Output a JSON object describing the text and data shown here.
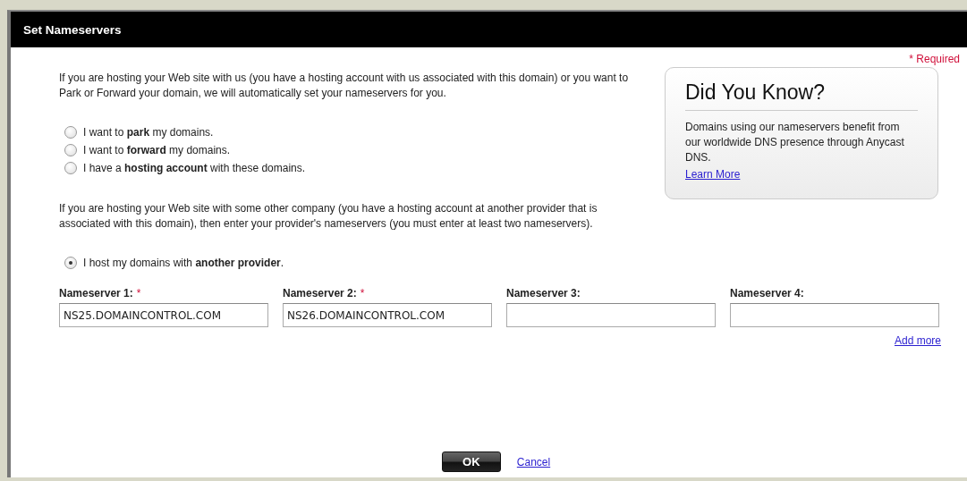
{
  "dialog": {
    "title": "Set Nameservers",
    "required_note": "* Required"
  },
  "intro": "If you are hosting your Web site with us (you have a hosting account with us associated with this domain) or you want to Park or Forward your domain, we will automatically set your nameservers for you.",
  "options": [
    {
      "label": "I want to **park** my domains.",
      "selected": false
    },
    {
      "label": "I want to **forward** my domains.",
      "selected": false
    },
    {
      "label": "I have a **hosting account** with these domains.",
      "selected": false
    }
  ],
  "other_intro": "If you are hosting your Web site with some other company (you have a hosting account at another provider that is associated with this domain), then enter your provider's nameservers (you must enter at least two nameservers).",
  "other_option": {
    "label": "I host my domains with **another provider**.",
    "selected": true
  },
  "nameservers": [
    {
      "label": "Nameserver 1:",
      "required_mark": "*",
      "value": "NS25.DOMAINCONTROL.COM"
    },
    {
      "label": "Nameserver 2:",
      "required_mark": "*",
      "value": "NS26.DOMAINCONTROL.COM"
    },
    {
      "label": "Nameserver 3:"
    },
    {
      "label": "Nameserver 4:"
    }
  ],
  "add_more": "Add more",
  "info_box": {
    "title": "Did You Know?",
    "text": "Domains using our nameservers benefit from our worldwide DNS presence through Anycast DNS.",
    "link": "Learn More"
  },
  "buttons": {
    "ok": "OK",
    "cancel": "Cancel"
  }
}
